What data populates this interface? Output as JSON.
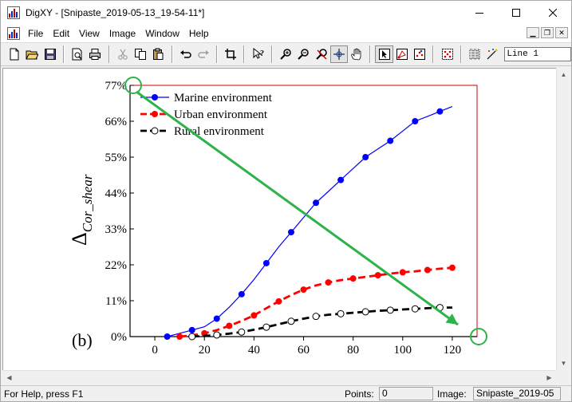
{
  "window": {
    "title": "DigXY - [Snipaste_2019-05-13_19-54-11*]",
    "controls": {
      "minimize": "—",
      "maximize": "☐",
      "close": "✕"
    }
  },
  "menubar": {
    "items": [
      "File",
      "Edit",
      "View",
      "Image",
      "Window",
      "Help"
    ]
  },
  "toolbar": {
    "line_combo_value": "Line 1"
  },
  "statusbar": {
    "help_text": "For Help, press F1",
    "points_label": "Points:",
    "points_value": "0",
    "image_label": "Image:",
    "image_value": "Snipaste_2019-05"
  },
  "chart_data": {
    "type": "line",
    "panel_label": "(b)",
    "ylabel_main": "Δ",
    "ylabel_sub": "Cor_shear",
    "xlim": [
      -10,
      130
    ],
    "ylim": [
      0,
      77
    ],
    "x_ticks": [
      0,
      20,
      40,
      60,
      80,
      100,
      120
    ],
    "x_tick_labels": [
      "0",
      "20",
      "40",
      "60",
      "80",
      "100",
      "120"
    ],
    "y_ticks": [
      0,
      11,
      22,
      33,
      44,
      55,
      66,
      77
    ],
    "y_tick_labels": [
      "0%",
      "11%",
      "22%",
      "33%",
      "44%",
      "55%",
      "66%",
      "77%"
    ],
    "series": [
      {
        "name": "Marine environment",
        "color": "#0000ff",
        "dash": "solid",
        "marker": "filled",
        "x": [
          5,
          10,
          15,
          20,
          25,
          30,
          35,
          40,
          45,
          50,
          55,
          60,
          65,
          70,
          75,
          80,
          85,
          90,
          95,
          100,
          105,
          110,
          115,
          120
        ],
        "y": [
          0.0,
          1.0,
          2.0,
          3.0,
          5.5,
          9.0,
          13.0,
          17.5,
          22.5,
          27.5,
          32.0,
          36.5,
          41.0,
          44.5,
          48.0,
          51.5,
          55.0,
          57.5,
          60.0,
          63.0,
          66.0,
          67.5,
          69.0,
          70.5
        ],
        "marker_x": [
          5,
          15,
          25,
          35,
          45,
          55,
          65,
          75,
          85,
          95,
          105,
          115
        ]
      },
      {
        "name": "Urban   environment",
        "color": "#ff0000",
        "dash": "dashed",
        "marker": "filled",
        "x": [
          10,
          15,
          20,
          25,
          30,
          35,
          40,
          45,
          50,
          55,
          60,
          65,
          70,
          75,
          80,
          85,
          90,
          95,
          100,
          105,
          110,
          115,
          120
        ],
        "y": [
          0.0,
          0.4,
          1.0,
          2.0,
          3.3,
          4.8,
          6.5,
          8.7,
          10.8,
          12.7,
          14.4,
          15.7,
          16.6,
          17.3,
          17.8,
          18.3,
          18.8,
          19.3,
          19.7,
          20.0,
          20.4,
          20.8,
          21.1
        ],
        "marker_x": [
          10,
          20,
          30,
          40,
          50,
          60,
          70,
          80,
          90,
          100,
          110,
          120
        ]
      },
      {
        "name": "Rural    environment",
        "color": "#000000",
        "dash": "dashed",
        "marker": "hollow",
        "x": [
          15,
          20,
          25,
          30,
          35,
          40,
          45,
          50,
          55,
          60,
          65,
          70,
          75,
          80,
          85,
          90,
          95,
          100,
          105,
          110,
          115,
          120
        ],
        "y": [
          0.0,
          0.2,
          0.5,
          0.9,
          1.4,
          2.1,
          2.9,
          3.8,
          4.7,
          5.5,
          6.2,
          6.7,
          7.0,
          7.3,
          7.6,
          7.9,
          8.1,
          8.3,
          8.5,
          8.7,
          8.9,
          8.9
        ],
        "marker_x": [
          15,
          25,
          35,
          45,
          55,
          65,
          75,
          85,
          95,
          105,
          115
        ]
      }
    ],
    "calibration_arrow": {
      "from": [
        -10,
        77
      ],
      "to": [
        130,
        0
      ],
      "color": "#2db34a"
    }
  }
}
